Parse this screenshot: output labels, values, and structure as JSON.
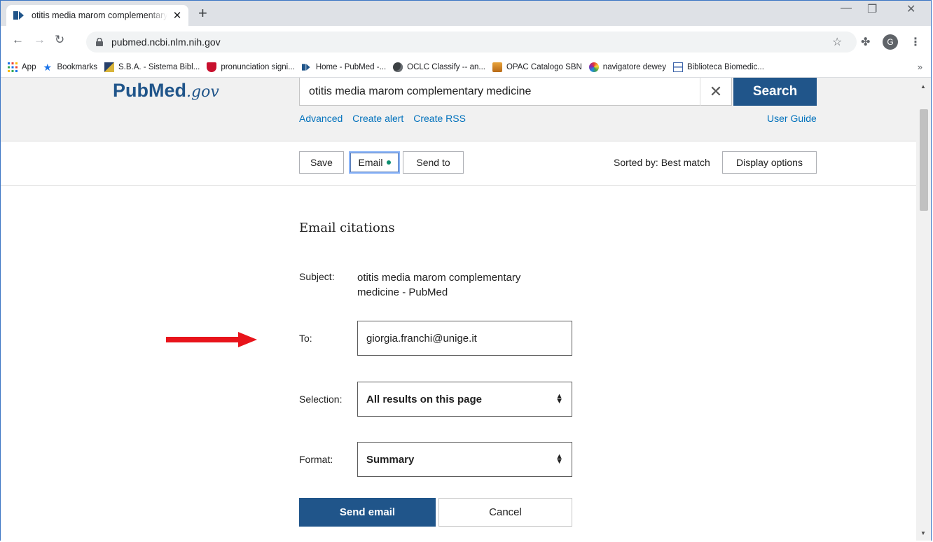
{
  "browser": {
    "tab_title": "otitis media marom complementary medicine - PubMed",
    "tab_close": "✕",
    "new_tab": "+",
    "url": "pubmed.ncbi.nlm.nih.gov",
    "avatar_letter": "G",
    "bookmarks": [
      {
        "label": "App",
        "icon": "apps-grid-icon"
      },
      {
        "label": "Bookmarks",
        "icon": "star-icon"
      },
      {
        "label": "S.B.A. - Sistema Bibl...",
        "icon": "sba-icon"
      },
      {
        "label": "pronunciation signi...",
        "icon": "cambridge-shield-icon"
      },
      {
        "label": "Home - PubMed -...",
        "icon": "pubmed-icon"
      },
      {
        "label": "OCLC Classify -- an...",
        "icon": "globe-icon"
      },
      {
        "label": "OPAC Catalogo SBN",
        "icon": "opac-icon"
      },
      {
        "label": "navigatore dewey",
        "icon": "dewey-icon"
      },
      {
        "label": "Biblioteca Biomedic...",
        "icon": "library-icon"
      }
    ],
    "bookmarks_more": "»"
  },
  "header": {
    "logo_pub": "Pub",
    "logo_med": "Med",
    "logo_gov": ".gov",
    "search_query": "otitis media marom complementary medicine",
    "search_button": "Search",
    "links": [
      "Advanced",
      "Create alert",
      "Create RSS"
    ],
    "user_guide": "User Guide"
  },
  "actions": {
    "save": "Save",
    "email": "Email",
    "send_to": "Send to",
    "sorted_by": "Sorted by: Best match",
    "display_options": "Display options"
  },
  "email_form": {
    "title": "Email citations",
    "subject_label": "Subject:",
    "subject_value": "otitis media marom complementary medicine - PubMed",
    "to_label": "To:",
    "to_value": "giorgia.franchi@unige.it",
    "selection_label": "Selection:",
    "selection_value": "All results on this page",
    "format_label": "Format:",
    "format_value": "Summary",
    "send_button": "Send email",
    "cancel_button": "Cancel"
  },
  "colors": {
    "pubmed_blue": "#20558a",
    "link_blue": "#0071bc",
    "annotation_arrow": "#e8141b"
  }
}
